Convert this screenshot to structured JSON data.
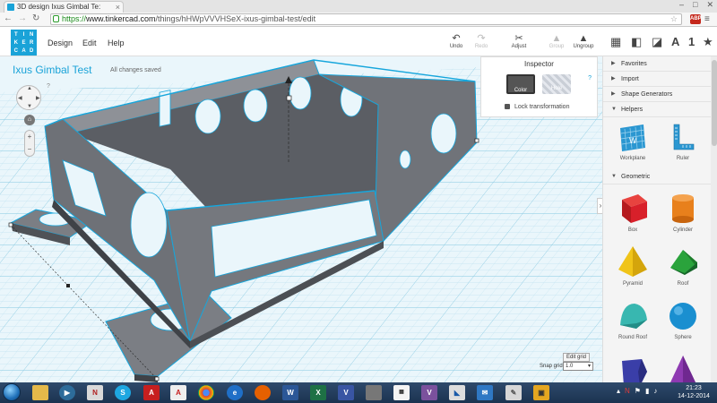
{
  "browser": {
    "tab_title": "3D design Ixus Gimbal Te:",
    "url_secure": "https://",
    "url_host": "www.tinkercad.com",
    "url_path": "/things/hHWpVVVHSeX-ixus-gimbal-test/edit",
    "extension_badge": "ABP"
  },
  "logo_letters": [
    "T",
    "I",
    "N",
    "K",
    "E",
    "R",
    "C",
    "A",
    "D"
  ],
  "menu": {
    "design": "Design",
    "edit": "Edit",
    "help": "Help"
  },
  "tools": {
    "undo": "Undo",
    "redo": "Redo",
    "adjust": "Adjust",
    "group": "Group",
    "ungroup": "Ungroup"
  },
  "view_icons": [
    "grid-view-icon",
    "box-view-icon",
    "bricks-view-icon",
    "text-view-icon",
    "number-view-icon",
    "favorite-view-icon"
  ],
  "view_icon_text": {
    "letter": "A",
    "number": "1",
    "star": "★"
  },
  "design": {
    "title": "Ixus Gimbal Test",
    "status": "All changes saved"
  },
  "navcube_help": "?",
  "inspector": {
    "title": "Inspector",
    "color_label": "Color",
    "hole_label": "Hole",
    "help": "?",
    "lock_label": "Lock transformation"
  },
  "grid": {
    "edit_button": "Edit grid",
    "snap_label": "Snap grid",
    "snap_value": "1.0"
  },
  "sidebar": {
    "sections": {
      "favorites": "Favorites",
      "import": "Import",
      "shape_generators": "Shape Generators",
      "helpers": "Helpers",
      "geometric": "Geometric"
    },
    "helpers": [
      {
        "name": "Workplane"
      },
      {
        "name": "Ruler"
      }
    ],
    "shapes": [
      {
        "name": "Box",
        "color": "#d8202a"
      },
      {
        "name": "Cylinder",
        "color": "#e8801c"
      },
      {
        "name": "Pyramid",
        "color": "#f0c419"
      },
      {
        "name": "Roof",
        "color": "#2aa33c"
      },
      {
        "name": "Round Roof",
        "color": "#38b7b0"
      },
      {
        "name": "Sphere",
        "color": "#1a8fd0"
      },
      {
        "name": "",
        "color": "#3a3ea8"
      },
      {
        "name": "",
        "color": "#8e3ab2"
      }
    ]
  },
  "taskbar": {
    "apps": [
      "explorer",
      "media",
      "notes",
      "skype",
      "acrobat",
      "chrome",
      "ie",
      "firefox",
      "word",
      "excel",
      "visio",
      "tool",
      "viber",
      "misc",
      "mail",
      "stickies",
      "paint",
      "ftp"
    ],
    "clock_time": "21:23",
    "clock_date": "14-12-2014"
  }
}
